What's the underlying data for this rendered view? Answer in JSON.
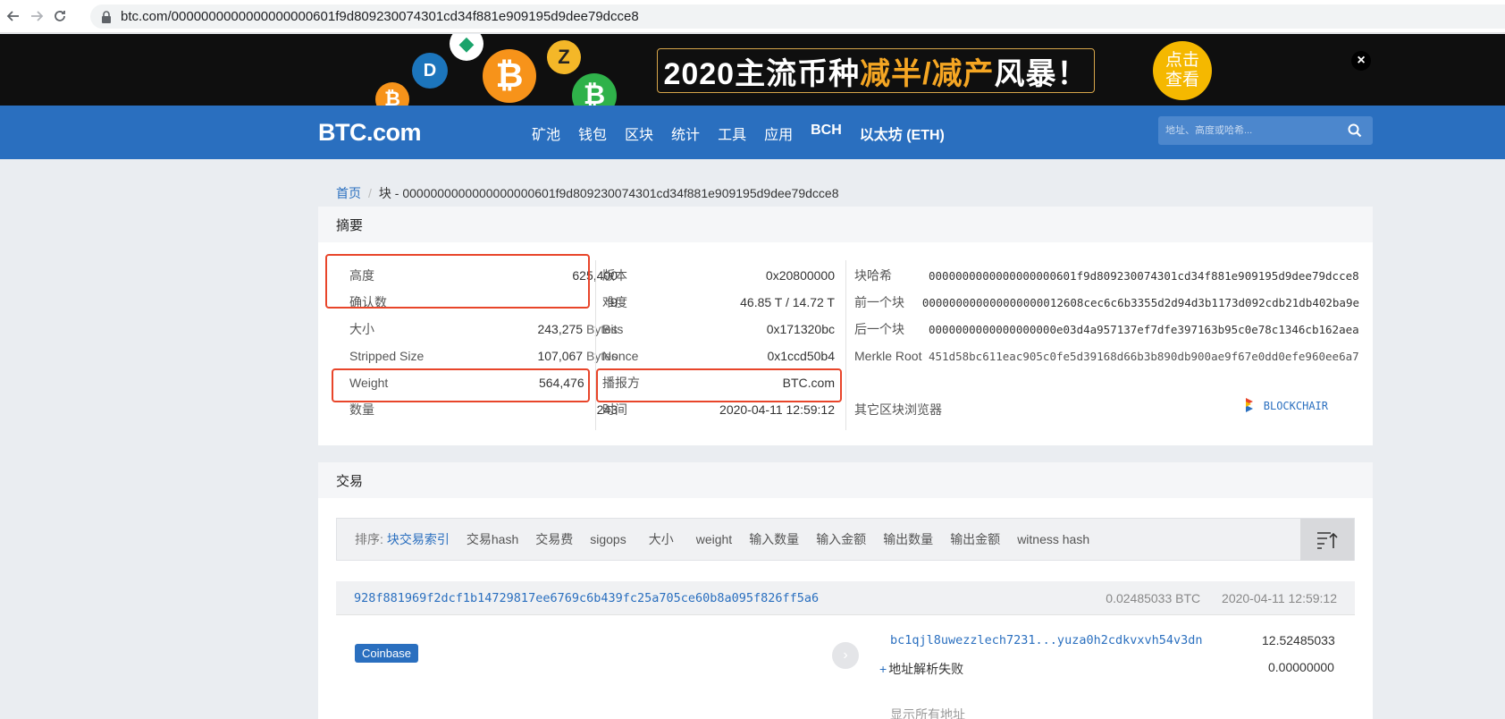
{
  "browser": {
    "url": "btc.com/0000000000000000000601f9d809230074301cd34f881e909195d9dee79dcce8"
  },
  "banner": {
    "title_prefix": "2020主流币种",
    "title_highlight": "减半/减产",
    "title_suffix": "风暴！",
    "cta": "点击查看",
    "close": "×"
  },
  "nav": {
    "logo": "BTC.com",
    "items": [
      "矿池",
      "钱包",
      "区块",
      "统计",
      "工具",
      "应用",
      "BCH",
      "以太坊 (ETH)"
    ],
    "search_placeholder": "地址、高度或哈希..."
  },
  "breadcrumb": {
    "home": "首页",
    "current": "块 - 0000000000000000000601f9d809230074301cd34f881e909195d9dee79dcce8"
  },
  "summary": {
    "title": "摘要",
    "col1": [
      {
        "k": "高度",
        "v": "625,400",
        "unit": ""
      },
      {
        "k": "确认数",
        "v": "9",
        "unit": ""
      },
      {
        "k": "大小",
        "v": "243,275",
        "unit": "Bytes"
      },
      {
        "k": "Stripped Size",
        "v": "107,067",
        "unit": "Bytes"
      },
      {
        "k": "Weight",
        "v": "564,476",
        "unit": ""
      },
      {
        "k": "数量",
        "v": "243",
        "unit": ""
      }
    ],
    "col2": [
      {
        "k": "版本",
        "v": "0x20800000"
      },
      {
        "k": "难度",
        "v": "46.85 T / 14.72 T"
      },
      {
        "k": "Bits",
        "v": "0x171320bc"
      },
      {
        "k": "Nonce",
        "v": "0x1ccd50b4"
      },
      {
        "k": "播报方",
        "v": "BTC.com"
      },
      {
        "k": "时间",
        "v": "2020-04-11 12:59:12"
      }
    ],
    "col3": [
      {
        "k": "块哈希",
        "v": "0000000000000000000601f9d809230074301cd34f881e909195d9dee79dcce8"
      },
      {
        "k": "前一个块",
        "v": "000000000000000000012608cec6c6b3355d2d94d3b1173d092cdb21db402ba9e"
      },
      {
        "k": "后一个块",
        "v": "0000000000000000000e03d4a957137ef7dfe397163b95c0e78c1346cb162aea"
      },
      {
        "k": "Merkle Root",
        "v": "451d58bc611eac905c0fe5d39168d66b3b890db900ae9f67e0dd0efe960ee6a7"
      }
    ],
    "explorers_label": "其它区块浏览器",
    "explorer_name": "BLOCKCHAIR"
  },
  "transactions": {
    "title": "交易",
    "sort_label": "排序:",
    "sort_options": [
      "块交易索引",
      "交易hash",
      "交易费",
      "sigops",
      "大小",
      "weight",
      "输入数量",
      "输入金额",
      "输出数量",
      "输出金额",
      "witness hash"
    ],
    "tx": {
      "hash": "928f881969f2dcf1b14729817ee6769c6b439fc25a705ce60b8a095f826ff5a6",
      "amount": "0.02485033 BTC",
      "time": "2020-04-11 12:59:12",
      "input": "Coinbase",
      "output_address": "bc1qjl8uwezzlech7231...yuza0h2cdkvxvh54v3dn",
      "output_value": "12.52485033",
      "fail_text": "地址解析失败",
      "fail_value": "0.00000000",
      "show_all": "显示所有地址"
    }
  }
}
